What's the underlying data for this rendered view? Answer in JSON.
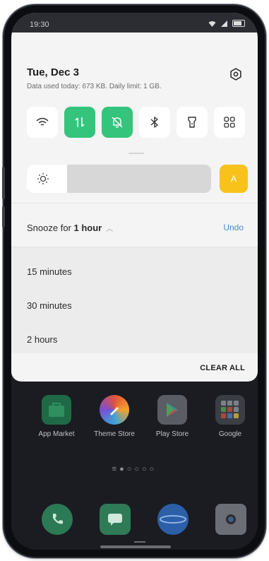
{
  "status_bar": {
    "time": "19:30"
  },
  "shade": {
    "date": "Tue, Dec 3",
    "data_usage": "Data used today: 673 KB. Daily limit: 1 GB.",
    "quick_tiles": [
      {
        "name": "wifi-icon",
        "on": false
      },
      {
        "name": "mobile-data-icon",
        "on": true
      },
      {
        "name": "silent-mode-icon",
        "on": true
      },
      {
        "name": "bluetooth-icon",
        "on": false
      },
      {
        "name": "flashlight-icon",
        "on": false
      },
      {
        "name": "more-tiles-icon",
        "on": false
      }
    ],
    "brightness": {
      "level": 0.22,
      "auto_label": "A"
    },
    "snooze": {
      "prefix": "Snooze for ",
      "duration": "1 hour",
      "undo": "Undo"
    },
    "options": [
      "15 minutes",
      "30 minutes",
      "2 hours"
    ],
    "clear_all": "CLEAR ALL",
    "colors": {
      "accent_green": "#35c47c",
      "auto_yellow": "#f8c21b",
      "link_blue": "#4b86d6"
    }
  },
  "home": {
    "apps": [
      "App Market",
      "Theme Store",
      "Play Store",
      "Google"
    ]
  }
}
